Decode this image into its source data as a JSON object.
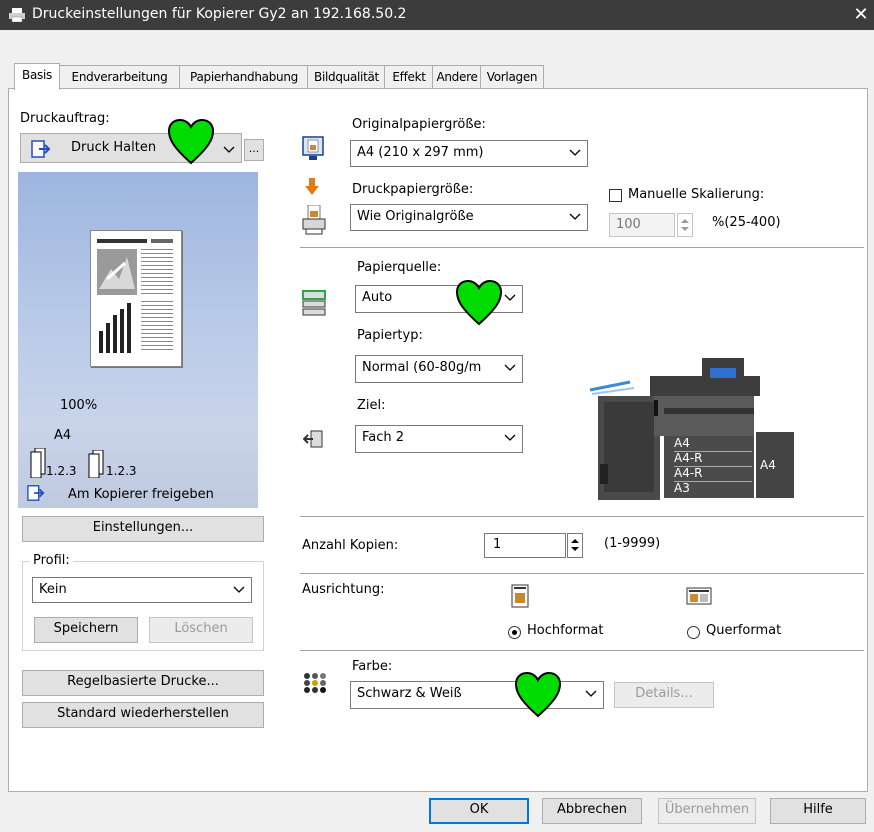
{
  "window": {
    "title": "Druckeinstellungen für Kopierer Gy2 an 192.168.50.2",
    "close": "✕"
  },
  "tabs": [
    "Basis",
    "Endverarbeitung",
    "Papierhandhabung",
    "Bildqualität",
    "Effekt",
    "Andere",
    "Vorlagen"
  ],
  "left": {
    "job_label": "Druckauftrag:",
    "job_value": "Druck Halten",
    "job_more": "...",
    "preview": {
      "scale": "100%",
      "paper": "A4",
      "collate1": "1.2.3",
      "collate2": "1.2.3",
      "release": "Am Kopierer freigeben"
    },
    "settings_button": "Einstellungen...",
    "profile_label": "Profil:",
    "profile_value": "Kein",
    "save_button": "Speichern",
    "delete_button": "Löschen",
    "rule_button": "Regelbasierte Drucke...",
    "restore_button": "Standard wiederherstellen"
  },
  "main": {
    "orig_label": "Originalpapiergröße:",
    "orig_value": "A4 (210 x 297 mm)",
    "print_label": "Druckpapiergröße:",
    "print_value": "Wie Originalgröße",
    "manual_scale_label": "Manuelle Skalierung:",
    "scale_value": "100",
    "scale_range": "%(25-400)",
    "source_label": "Papierquelle:",
    "source_value": "Auto",
    "type_label": "Papiertyp:",
    "type_value": "Normal (60-80g/m",
    "dest_label": "Ziel:",
    "dest_value": "Fach 2",
    "trays": [
      "A4",
      "A4-R",
      "A4-R",
      "A3"
    ],
    "side_tray": "A4",
    "copies_label": "Anzahl Kopien:",
    "copies_value": "1",
    "copies_range": "(1-9999)",
    "orientation_label": "Ausrichtung:",
    "portrait": "Hochformat",
    "landscape": "Querformat",
    "color_label": "Farbe:",
    "color_value": "Schwarz & Weiß",
    "details_button": "Details..."
  },
  "footer": {
    "ok": "OK",
    "cancel": "Abbrechen",
    "apply": "Übernehmen",
    "help": "Hilfe"
  },
  "colors": {
    "titlebar": "#3c3c3c",
    "heart": "#00dc00",
    "accent": "#0078d7",
    "paper_icon_tray": "#2da44e"
  }
}
